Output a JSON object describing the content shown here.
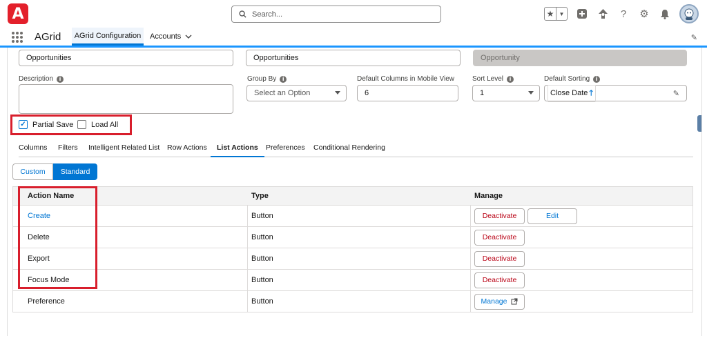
{
  "header": {
    "logo_text": "A",
    "search_placeholder": "Search...",
    "icons": [
      "favorites-star-icon",
      "add-icon",
      "trailhead-icon",
      "help-icon",
      "setup-gear-icon",
      "notifications-bell-icon",
      "user-avatar"
    ]
  },
  "nav": {
    "app_name": "AGrid",
    "tabs": [
      {
        "label": "AGrid Configuration",
        "active": true
      },
      {
        "label": "Accounts",
        "active": false
      }
    ]
  },
  "form": {
    "row1": {
      "field1": "Opportunities",
      "field2": "Opportunities",
      "field3": "Opportunity"
    },
    "description_label": "Description",
    "group_by_label": "Group By",
    "group_by_value": "Select an Option",
    "mobile_columns_label": "Default Columns in Mobile View",
    "mobile_columns_value": "6",
    "sort_level_label": "Sort Level",
    "sort_level_value": "1",
    "default_sorting_label": "Default Sorting",
    "default_sorting_value": "Close Date",
    "sort_direction_symbol": "🡑",
    "partial_save_label": "Partial Save",
    "partial_save_checked": true,
    "load_all_label": "Load All",
    "load_all_checked": false
  },
  "tabs": [
    {
      "label": "Columns",
      "active": false
    },
    {
      "label": "Filters",
      "active": false
    },
    {
      "label": "Intelligent Related List",
      "active": false
    },
    {
      "label": "Row Actions",
      "active": false
    },
    {
      "label": "List Actions",
      "active": true
    },
    {
      "label": "Preferences",
      "active": false
    },
    {
      "label": "Conditional Rendering",
      "active": false
    }
  ],
  "segmented": {
    "custom_label": "Custom",
    "standard_label": "Standard",
    "selected": "Standard"
  },
  "table": {
    "headers": [
      "Action Name",
      "Type",
      "Manage"
    ],
    "rows": [
      {
        "name": "Create",
        "type": "Button",
        "buttons": [
          "Deactivate",
          "Edit"
        ],
        "is_link": true
      },
      {
        "name": "Delete",
        "type": "Button",
        "buttons": [
          "Deactivate"
        ],
        "is_link": false
      },
      {
        "name": "Export",
        "type": "Button",
        "buttons": [
          "Deactivate"
        ],
        "is_link": false
      },
      {
        "name": "Focus Mode",
        "type": "Button",
        "buttons": [
          "Deactivate"
        ],
        "is_link": false
      },
      {
        "name": "Preference",
        "type": "Button",
        "buttons": [
          "Manage"
        ],
        "is_link": false
      }
    ]
  },
  "colors": {
    "brand_red": "#e3202b",
    "accent_blue": "#0176d3",
    "deactivate_red": "#ba0517",
    "highlight_red": "#d81e2c"
  }
}
